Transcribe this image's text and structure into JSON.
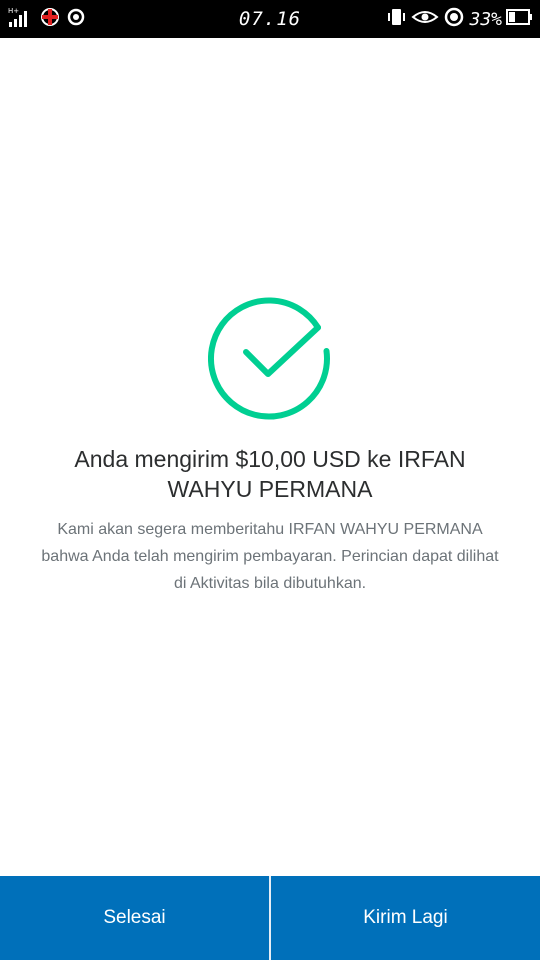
{
  "status_bar": {
    "time": "07.16",
    "battery": "33%",
    "left_icons": [
      "signal-icon",
      "hotspot-icon",
      "sync-icon"
    ],
    "right_icons": [
      "vibrate-icon",
      "eye-icon",
      "location-icon",
      "battery-icon"
    ]
  },
  "colors": {
    "accent_green": "#00cf92",
    "primary_blue": "#0070ba",
    "headline_text": "#2c2e2f",
    "body_text": "#6c7378"
  },
  "confirmation": {
    "icon": "success-check-icon",
    "headline": "Anda mengirim $10,00 USD ke IRFAN WAHYU PERMANA",
    "message": "Kami akan segera memberitahu IRFAN WAHYU PERMANA bahwa Anda telah mengirim pembayaran. Perincian dapat dilihat di Aktivitas bila dibutuhkan."
  },
  "actions": {
    "done_label": "Selesai",
    "send_again_label": "Kirim Lagi"
  }
}
